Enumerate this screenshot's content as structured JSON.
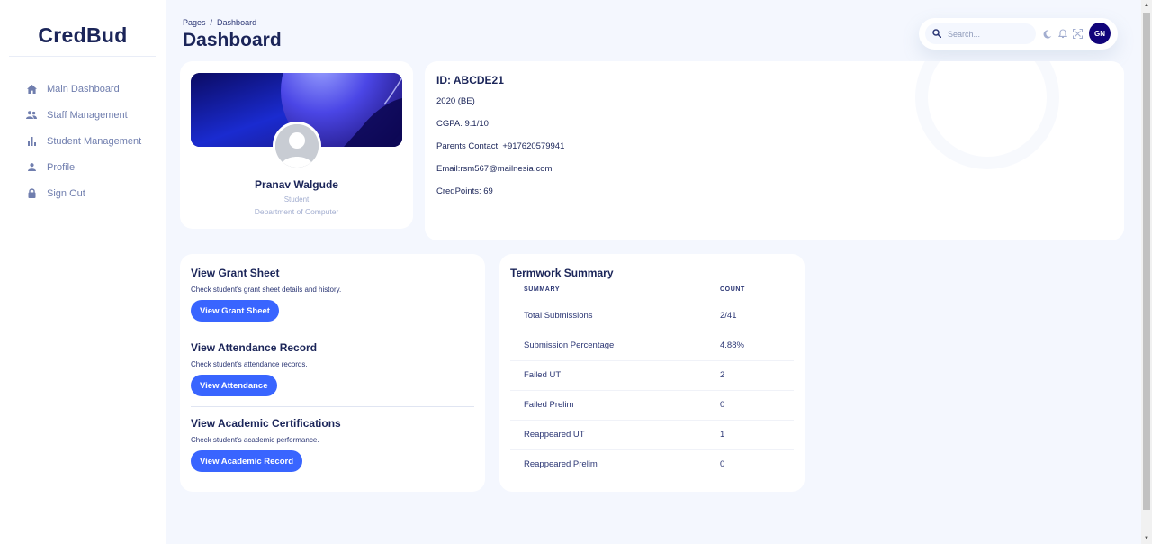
{
  "app": {
    "brand": "CredBud"
  },
  "sidebar": {
    "items": [
      {
        "label": "Main Dashboard",
        "icon": "home-icon"
      },
      {
        "label": "Staff Management",
        "icon": "people-icon"
      },
      {
        "label": "Student Management",
        "icon": "bar-chart-icon"
      },
      {
        "label": "Profile",
        "icon": "person-icon"
      },
      {
        "label": "Sign Out",
        "icon": "lock-icon"
      }
    ]
  },
  "header": {
    "breadcrumb_root": "Pages",
    "breadcrumb_sep": "/",
    "breadcrumb_current": "Dashboard",
    "title": "Dashboard"
  },
  "topbar": {
    "search_placeholder": "Search...",
    "avatar_initials": "GN",
    "avatar_color": "#11047a"
  },
  "profile": {
    "name": "Pranav Walgude",
    "role": "Student",
    "department": "Department of Computer"
  },
  "info": {
    "id": "ID: ABCDE21",
    "year": "2020 (BE)",
    "cgpa": "CGPA: 9.1/10",
    "parents_contact": "Parents Contact: +917620579941",
    "email": "Email:rsm567@mailnesia.com",
    "credpoints": "CredPoints: 69"
  },
  "actions": [
    {
      "title": "View Grant Sheet",
      "desc": "Check student's grant sheet details and history.",
      "button": "View Grant Sheet"
    },
    {
      "title": "View Attendance Record",
      "desc": "Check student's attendance records.",
      "button": "View Attendance"
    },
    {
      "title": "View Academic Certifications",
      "desc": "Check student's academic performance.",
      "button": "View Academic Record"
    }
  ],
  "termwork": {
    "title": "Termwork Summary",
    "headers": [
      "SUMMARY",
      "COUNT"
    ],
    "rows": [
      {
        "label": "Total Submissions",
        "count": "2/41"
      },
      {
        "label": "Submission Percentage",
        "count": "4.88%"
      },
      {
        "label": "Failed UT",
        "count": "2"
      },
      {
        "label": "Failed Prelim",
        "count": "0"
      },
      {
        "label": "Reappeared UT",
        "count": "1"
      },
      {
        "label": "Reappeared Prelim",
        "count": "0"
      }
    ]
  },
  "colors": {
    "accent": "#3965ff",
    "text": "#1b2559",
    "muted": "#a3aed0",
    "background": "#f4f7fe"
  }
}
